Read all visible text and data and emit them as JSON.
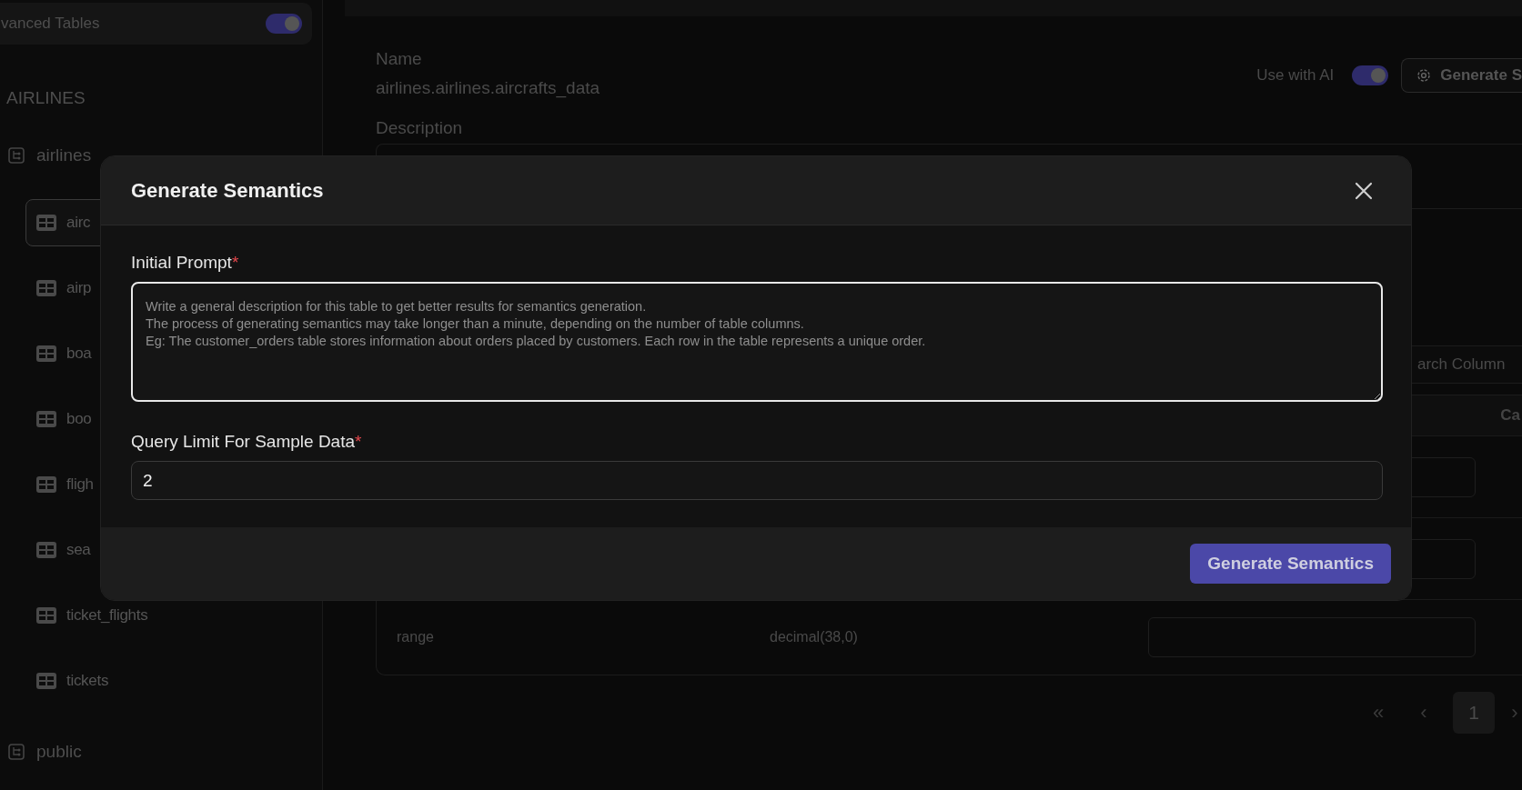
{
  "sidebar": {
    "toggle": {
      "label": "vanced Tables",
      "on": true
    },
    "section": "AIRLINES",
    "schemas": [
      {
        "name": "airlines",
        "children": [
          {
            "name": "airc",
            "selected": true
          },
          {
            "name": "airp",
            "selected": false
          },
          {
            "name": "boa",
            "selected": false
          },
          {
            "name": "boo",
            "selected": false
          },
          {
            "name": "fligh",
            "selected": false
          },
          {
            "name": "sea",
            "selected": false
          },
          {
            "name": "ticket_flights",
            "selected": false
          },
          {
            "name": "tickets",
            "selected": false
          }
        ]
      },
      {
        "name": "public"
      }
    ]
  },
  "main": {
    "name_label": "Name",
    "name_value": "airlines.airlines.aircrafts_data",
    "use_with_ai": {
      "label": "Use with AI",
      "on": true
    },
    "generate_button": "Generate S",
    "description_label": "Description",
    "search": {
      "placeholder": "arch Column"
    },
    "table": {
      "header": "Ca",
      "rows": [
        {
          "kind": "hidden"
        },
        {
          "kind": "hidden"
        },
        {
          "kind": "row",
          "name": "range",
          "type": "decimal(38,0)"
        }
      ]
    },
    "pagination": {
      "first": "«",
      "prev": "‹",
      "pages": [
        {
          "label": "1",
          "selected": true
        }
      ],
      "next": "›"
    }
  },
  "modal": {
    "title": "Generate Semantics",
    "required_mark": "*",
    "fields": [
      {
        "kind": "textarea",
        "label": "Initial Prompt",
        "required": true,
        "placeholder": "Write a general description for this table to get better results for semantics generation.\nThe process of generating semantics may take longer than a minute, depending on the number of table columns.\nEg: The customer_orders table stores information about orders placed by customers. Each row in the table represents a unique order."
      },
      {
        "kind": "input",
        "label": "Query Limit For Sample Data",
        "required": true,
        "value": "2"
      }
    ],
    "submit": "Generate Semantics"
  }
}
